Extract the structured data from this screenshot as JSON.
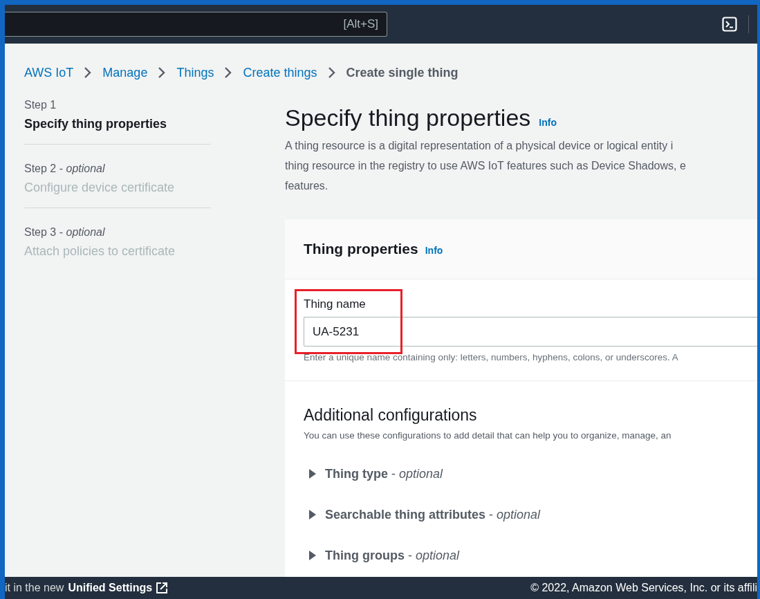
{
  "top_nav": {
    "search_shortcut": "[Alt+S]"
  },
  "breadcrumbs": [
    {
      "label": "AWS IoT",
      "current": false
    },
    {
      "label": "Manage",
      "current": false
    },
    {
      "label": "Things",
      "current": false
    },
    {
      "label": "Create things",
      "current": false
    },
    {
      "label": "Create single thing",
      "current": true
    }
  ],
  "steps": [
    {
      "step": "Step 1",
      "title": "Specify thing properties",
      "selected": true
    },
    {
      "step": "Step 2 - *optional*",
      "title": "Configure device certificate",
      "selected": false
    },
    {
      "step": "Step 3 - *optional*",
      "title": "Attach policies to certificate",
      "selected": false
    }
  ],
  "page": {
    "title": "Specify thing properties",
    "info": "Info",
    "description_lines": [
      "A thing resource is a digital representation of a physical device or logical entity i",
      "thing resource in the registry to use AWS IoT features such as Device Shadows, e",
      "features."
    ]
  },
  "card": {
    "title": "Thing properties",
    "info": "Info",
    "thing_name": {
      "label": "Thing name",
      "value": "UA-5231",
      "hint": "Enter a unique name containing only: letters, numbers, hyphens, colons, or underscores. A",
      "highlighted": true
    },
    "additional": {
      "title": "Additional configurations",
      "description": "You can use these configurations to add detail that can help you to organize, manage, an"
    },
    "sections": [
      {
        "title": "**Thing type** - *optional*",
        "expanded": false
      },
      {
        "title": "**Searchable thing attributes** - *optional*",
        "expanded": false
      },
      {
        "title": "**Thing groups** - *optional*",
        "expanded": false
      }
    ]
  },
  "footer": {
    "notice": "it in the new",
    "link": "Unified Settings",
    "copyright": "© 2022, Amazon Web Services, Inc. or its affili"
  }
}
